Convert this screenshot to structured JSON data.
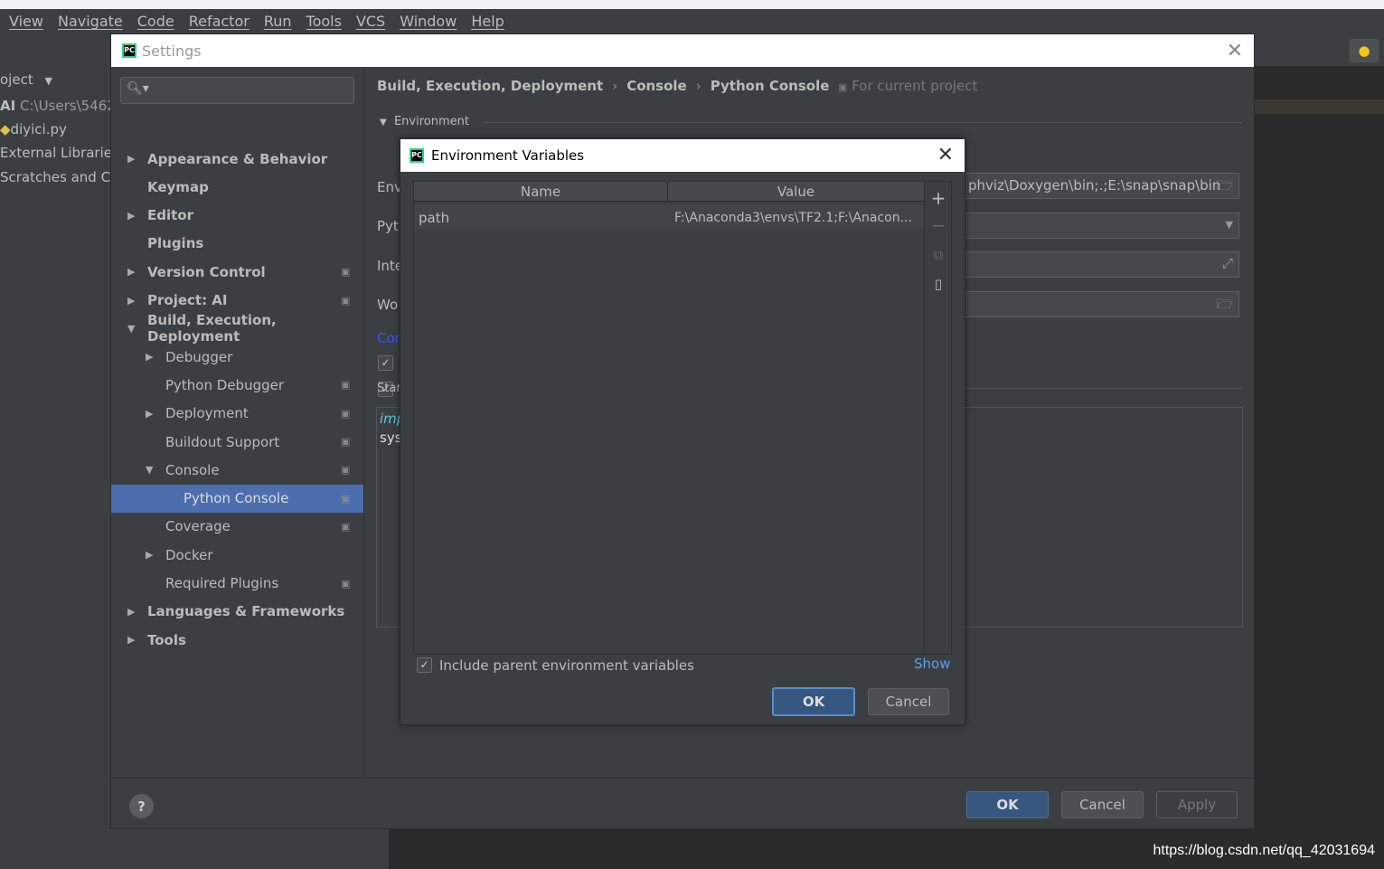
{
  "menu": [
    "View",
    "Navigate",
    "Code",
    "Refactor",
    "Run",
    "Tools",
    "VCS",
    "Window",
    "Help"
  ],
  "project_panel": {
    "header": "oject",
    "root": "AI",
    "root_path": "C:\\Users\\5462(",
    "file": "diyici.py",
    "ext_libs": "External Libraries",
    "scratches": "Scratches and Co"
  },
  "settings": {
    "title": "Settings",
    "search_placeholder": "",
    "tree": [
      {
        "label": "Appearance & Behavior",
        "bold": true,
        "arrow": "right",
        "level": 0
      },
      {
        "label": "Keymap",
        "bold": true,
        "level": 0
      },
      {
        "label": "Editor",
        "bold": true,
        "arrow": "right",
        "level": 0
      },
      {
        "label": "Plugins",
        "bold": true,
        "level": 0
      },
      {
        "label": "Version Control",
        "bold": true,
        "arrow": "right",
        "level": 0,
        "project": true
      },
      {
        "label": "Project: AI",
        "bold": true,
        "arrow": "right",
        "level": 0,
        "project": true
      },
      {
        "label": "Build, Execution, Deployment",
        "bold": true,
        "arrow": "down",
        "level": 0
      },
      {
        "label": "Debugger",
        "arrow": "right",
        "level": 1
      },
      {
        "label": "Python Debugger",
        "level": 1,
        "project": true
      },
      {
        "label": "Deployment",
        "arrow": "right",
        "level": 1,
        "project": true
      },
      {
        "label": "Buildout Support",
        "level": 1,
        "project": true
      },
      {
        "label": "Console",
        "arrow": "down",
        "level": 1,
        "project": true
      },
      {
        "label": "Python Console",
        "level": 2,
        "project": true,
        "selected": true
      },
      {
        "label": "Coverage",
        "level": 1,
        "project": true
      },
      {
        "label": "Docker",
        "arrow": "right",
        "level": 1
      },
      {
        "label": "Required Plugins",
        "level": 1,
        "project": true
      },
      {
        "label": "Languages & Frameworks",
        "bold": true,
        "arrow": "right",
        "level": 0
      },
      {
        "label": "Tools",
        "bold": true,
        "arrow": "right",
        "level": 0
      }
    ],
    "breadcrumb": [
      "Build, Execution, Deployment",
      "Console",
      "Python Console"
    ],
    "for_current_project": "For current project",
    "section_environment": "Environment",
    "labels": {
      "env": "Env",
      "python": "Pytl",
      "interpreter": "Inte",
      "working": "Wo",
      "conf": "Cor",
      "startup": "Star"
    },
    "env_field_value": "phviz\\Doxygen\\bin;.;E:\\snap\\snap\\bin",
    "script_lines": [
      "imp",
      "sys."
    ],
    "buttons": {
      "ok": "OK",
      "cancel": "Cancel",
      "apply": "Apply",
      "help": "?"
    }
  },
  "env_dialog": {
    "title": "Environment Variables",
    "columns": [
      "Name",
      "Value"
    ],
    "rows": [
      {
        "name": "path",
        "value": "F:\\Anaconda3\\envs\\TF2.1;F:\\Anacon..."
      }
    ],
    "include_parent_label": "Include parent environment variables",
    "include_parent_checked": true,
    "show_link": "Show",
    "ok": "OK",
    "cancel": "Cancel"
  },
  "watermark": "https://blog.csdn.net/qq_42031694",
  "colors": {
    "selection": "#4b6eaf",
    "link": "#589df6",
    "default_button": "#365880"
  }
}
